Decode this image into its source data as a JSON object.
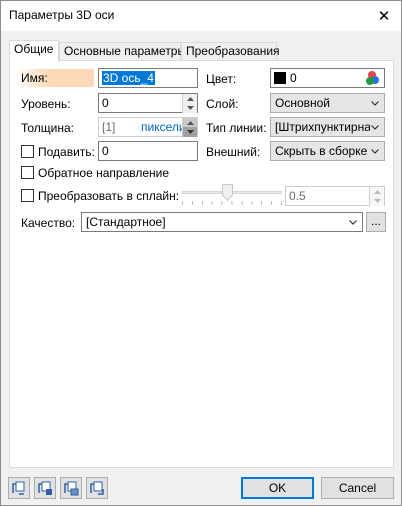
{
  "window": {
    "title": "Параметры 3D оси",
    "close_glyph": "✕"
  },
  "tabs": [
    {
      "label": "Общие"
    },
    {
      "label": "Основные параметры"
    },
    {
      "label": "Преобразования"
    }
  ],
  "form": {
    "name_label": "Имя:",
    "name_value": "3D ось_4",
    "level_label": "Уровень:",
    "level_value": "0",
    "thickness_label": "Толщина:",
    "thickness_value": "[1]",
    "thickness_unit": "пиксели",
    "raise_label": "Подавить:",
    "raise_value": "0",
    "reverse_label": "Обратное направление",
    "spline_label": "Преобразовать в сплайн:",
    "spline_value": "0.5",
    "quality_label": "Качество:",
    "quality_value": "[Стандартное]",
    "quality_more": "...",
    "color_label": "Цвет:",
    "color_value": "0",
    "color_swatch": "#000000",
    "layer_label": "Слой:",
    "layer_value": "Основной",
    "linetype_label": "Тип линии:",
    "linetype_value": "[Штрихпунктирная",
    "external_label": "Внешний:",
    "external_value": "Скрыть в сборке"
  },
  "colors": {
    "name_highlight": "#fbd9b8",
    "link_blue": "#0066cc",
    "accent": "#0078d7"
  },
  "footer": {
    "icons": [
      "copy-params-icon",
      "paste-params-icon",
      "save-params-icon",
      "load-params-icon"
    ],
    "ok_label": "OK",
    "cancel_label": "Cancel"
  }
}
